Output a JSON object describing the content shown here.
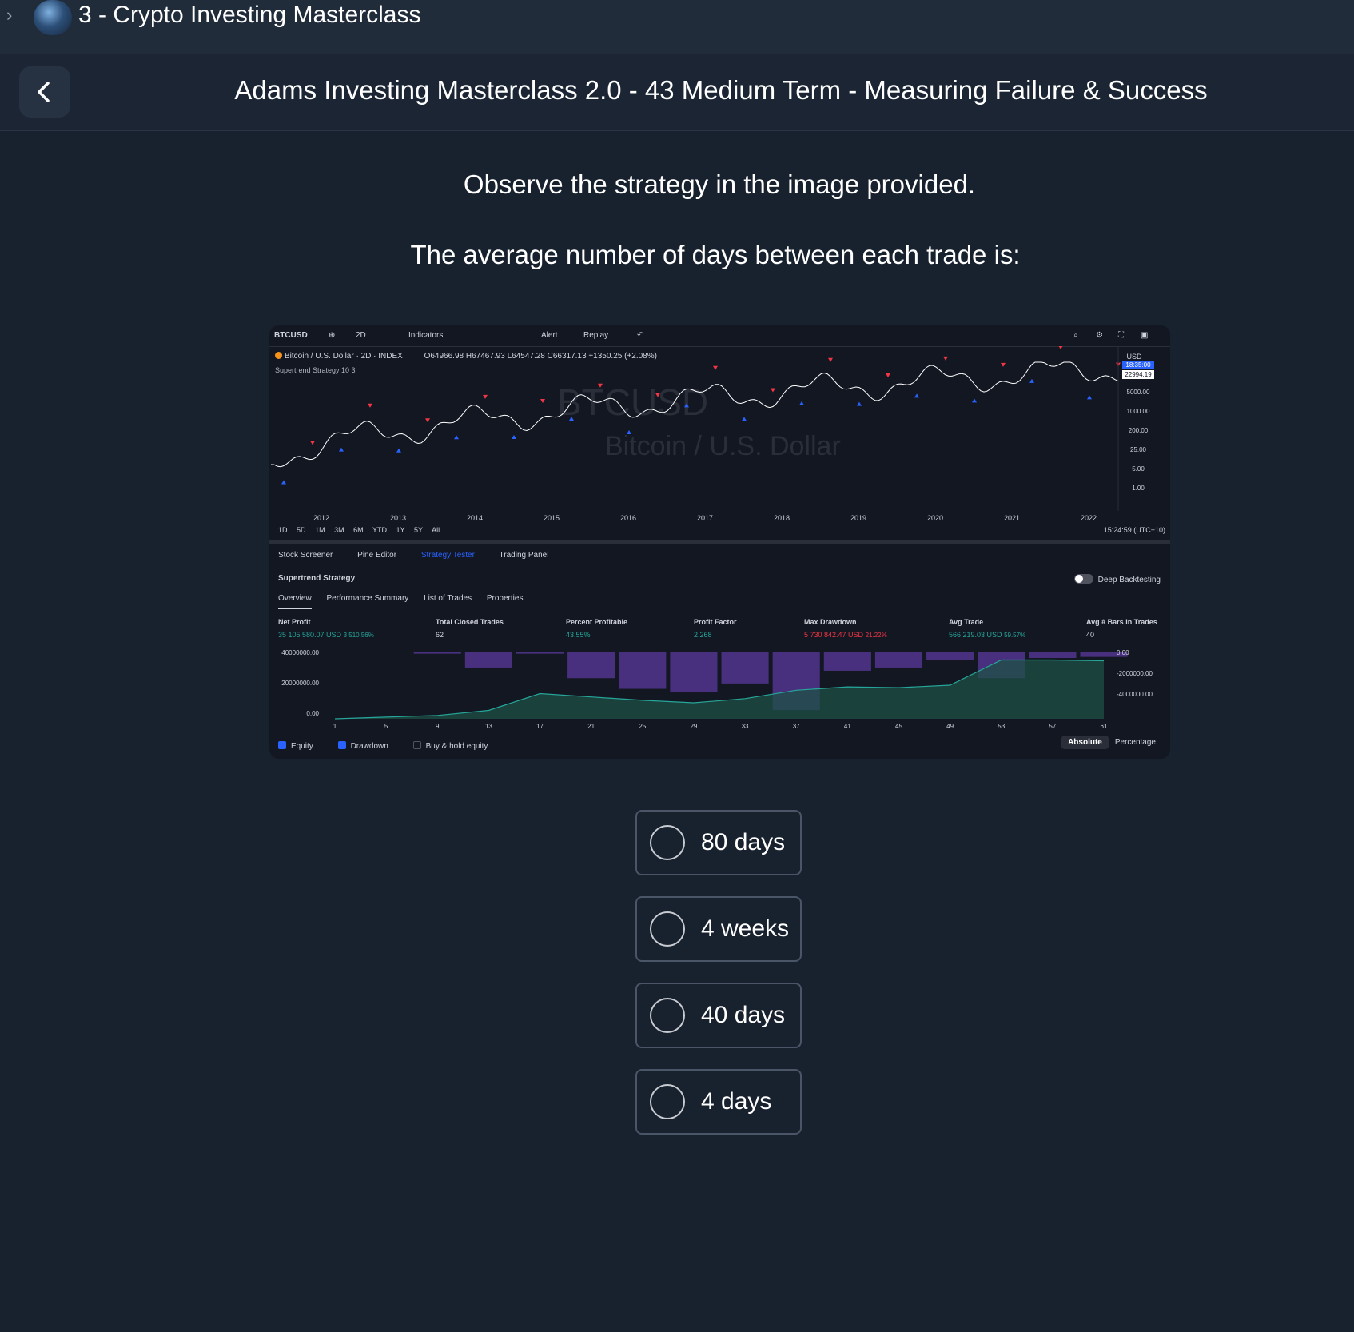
{
  "course": {
    "title": "3 - Crypto Investing Masterclass"
  },
  "lesson": {
    "title": "Adams Investing Masterclass 2.0 - 43 Medium Term - Measuring Failure & Success"
  },
  "question": {
    "line1": "Observe the strategy in the image provided.",
    "line2": "The average number of days between each trade is:"
  },
  "chart_panel": {
    "symbol": "BTCUSD",
    "interval": "2D",
    "toolbar": {
      "indicators": "Indicators",
      "alert": "Alert",
      "replay": "Replay"
    },
    "legend_title": "Bitcoin / U.S. Dollar · 2D · INDEX",
    "ohlc": "O64966.98 H67467.93 L64547.28 C66317.13 +1350.25 (+2.08%)",
    "strategy_label": "Supertrend Strategy 10 3",
    "watermark": "BTCUSD",
    "watermark_sub": "Bitcoin / U.S. Dollar",
    "currency": "USD",
    "price_tags": [
      "18:35:00",
      "22994.19"
    ],
    "price_axis": [
      "5000.00",
      "1000.00",
      "200.00",
      "25.00",
      "5.00",
      "1.00"
    ],
    "year_axis": [
      "2012",
      "2013",
      "2014",
      "2015",
      "2016",
      "2017",
      "2018",
      "2019",
      "2020",
      "2021",
      "2022"
    ],
    "ranges": [
      "1D",
      "5D",
      "1M",
      "3M",
      "6M",
      "YTD",
      "1Y",
      "5Y",
      "All"
    ],
    "clock": "15:24:59 (UTC+10)",
    "bottom_tabs": [
      "Stock Screener",
      "Pine Editor",
      "Strategy Tester",
      "Trading Panel"
    ],
    "strategy_name": "Supertrend Strategy",
    "deep_backtesting": "Deep Backtesting",
    "sub_tabs": [
      "Overview",
      "Performance Summary",
      "List of Trades",
      "Properties"
    ],
    "metrics": [
      {
        "label": "Net Profit",
        "value": "35 105 580.07 USD",
        "extra": "3 510.56%",
        "color": "#26a69a"
      },
      {
        "label": "Total Closed Trades",
        "value": "62",
        "extra": "",
        "color": "#d1d4dc"
      },
      {
        "label": "Percent Profitable",
        "value": "43.55%",
        "extra": "",
        "color": "#26a69a"
      },
      {
        "label": "Profit Factor",
        "value": "2.268",
        "extra": "",
        "color": "#26a69a"
      },
      {
        "label": "Max Drawdown",
        "value": "5 730 842.47 USD",
        "extra": "21.22%",
        "color": "#f23645"
      },
      {
        "label": "Avg Trade",
        "value": "566 219.03 USD",
        "extra": "59.57%",
        "color": "#26a69a"
      },
      {
        "label": "Avg # Bars in Trades",
        "value": "40",
        "extra": "",
        "color": "#d1d4dc"
      }
    ],
    "equity_left_axis": [
      "40000000.00",
      "20000000.00",
      "0.00"
    ],
    "equity_right_axis": [
      "0.00",
      "-2000000.00",
      "-4000000.00"
    ],
    "equity_x_axis": [
      "1",
      "5",
      "9",
      "13",
      "17",
      "21",
      "25",
      "29",
      "33",
      "37",
      "41",
      "45",
      "49",
      "53",
      "57",
      "61"
    ],
    "checkboxes": [
      "Equity",
      "Drawdown",
      "Buy & hold equity"
    ],
    "display_modes": [
      "Absolute",
      "Percentage"
    ]
  },
  "chart_data": {
    "type": "area",
    "x": [
      1,
      5,
      9,
      13,
      17,
      21,
      25,
      29,
      33,
      37,
      41,
      45,
      49,
      53,
      57,
      61
    ],
    "series": [
      {
        "name": "Equity",
        "values": [
          0,
          1000000,
          2000000,
          5000000,
          15000000,
          13000000,
          11000000,
          9500000,
          12000000,
          17000000,
          19000000,
          18500000,
          20000000,
          35000000,
          35000000,
          34500000
        ]
      },
      {
        "name": "Drawdown",
        "values": [
          0,
          0,
          -200000,
          -1500000,
          -200000,
          -2500000,
          -3500000,
          -3800000,
          -3000000,
          -5500000,
          -1800000,
          -1500000,
          -800000,
          -2500000,
          -600000,
          -500000
        ]
      }
    ],
    "ylim": [
      0,
      40000000
    ]
  },
  "answers": [
    {
      "label": "80 days"
    },
    {
      "label": "4 weeks"
    },
    {
      "label": "40 days"
    },
    {
      "label": "4 days"
    }
  ]
}
